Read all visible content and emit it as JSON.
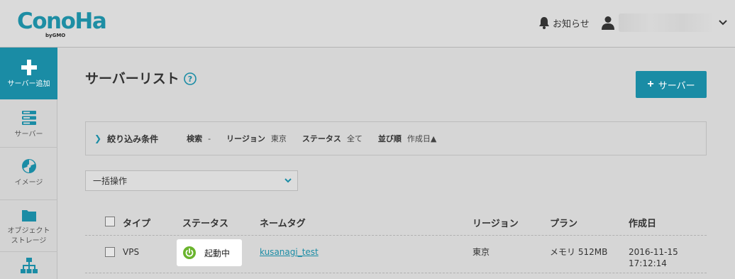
{
  "header": {
    "logo": {
      "text": "ConoHa",
      "sub": "byGMO"
    },
    "notice_label": "お知らせ",
    "icons": {
      "notice": "bell-icon",
      "user": "user-icon",
      "menu": "chevron-down-icon"
    }
  },
  "sidebar": {
    "items": [
      {
        "label": "サーバー追加",
        "icon": "plus-icon"
      },
      {
        "label": "サーバー",
        "icon": "server-icon"
      },
      {
        "label": "イメージ",
        "icon": "disc-icon"
      },
      {
        "label": "オブジェクト\nストレージ",
        "label_line1": "オブジェクト",
        "label_line2": "ストレージ",
        "icon": "folder-icon"
      },
      {
        "label": "",
        "icon": "network-icon"
      }
    ]
  },
  "main": {
    "title": "サーバーリスト",
    "add_button_label": "サーバー",
    "filter": {
      "title": "絞り込み条件",
      "search_key": "検索",
      "search_val": "-",
      "region_key": "リージョン",
      "region_val": "東京",
      "status_key": "ステータス",
      "status_val": "全て",
      "sort_key": "並び順",
      "sort_val": "作成日▲"
    },
    "bulk_action": {
      "selected": "一括操作"
    },
    "table": {
      "columns": [
        "タイプ",
        "ステータス",
        "ネームタグ",
        "リージョン",
        "プラン",
        "作成日"
      ],
      "rows": [
        {
          "type": "VPS",
          "status": "起動中",
          "name": "kusanagi_test",
          "region": "東京",
          "plan": "メモリ 512MB",
          "created_date": "2016-11-15",
          "created_time": "17:12:14"
        }
      ]
    }
  },
  "colors": {
    "accent": "#1a8ca5",
    "status_running": "#6ab42d"
  }
}
